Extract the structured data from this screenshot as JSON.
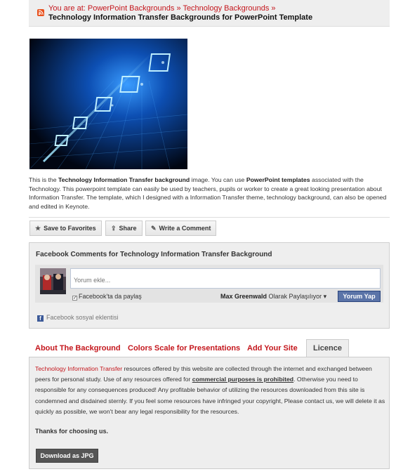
{
  "breadcrumb": {
    "prefix": "You are at:",
    "crumb1": "PowerPoint Backgrounds",
    "sep": "»",
    "crumb2": "Technology Backgrounds",
    "trail_end": "»",
    "title": "Technology Information Transfer Backgrounds for PowerPoint Template"
  },
  "description": {
    "p1": "This is the ",
    "b1": "Technology Information Transfer background",
    "p2": " image. You can use ",
    "b2": "PowerPoint templates",
    "p3": " associated with the Technology. This powerpoint template can easily be used by teachers, pupils or worker to create a great looking presentation about Information Transfer. The template, which I designed with a Information Transfer theme, technology background, can also be opened and edited in Keynote."
  },
  "actions": {
    "save": "Save to Favorites",
    "share": "Share",
    "comment": "Write a Comment"
  },
  "facebook": {
    "title": "Facebook Comments for Technology Information Transfer Background",
    "placeholder": "Yorum ekle...",
    "share_label": "Facebook'ta da paylaş",
    "user": "Max Greenwald",
    "posting_as": "Olarak Paylaşılıyor",
    "post_button": "Yorum Yap",
    "plugin_label": "Facebook sosyal eklentisi"
  },
  "tabs": [
    {
      "label": "About The Background"
    },
    {
      "label": "Colors Scale for Presentations"
    },
    {
      "label": "Add Your Site"
    },
    {
      "label": "Licence"
    }
  ],
  "licence": {
    "link": "Technology Information Transfer",
    "t1": " resources offered by this website are collected through the internet and exchanged between peers for personal study. Use of any resources offered for ",
    "b1": "commercial purposes is prohibited",
    "t2": ". Otherwise you need to responsible for any consequences produced! Any profitable behavior of utilizing the resources downloaded from this site is condemned and disdained sternly. If you feel some resources have infringed your copyright, Please contact us, we will delete it as quickly as possible, we won't bear any legal responsibility for the resources.",
    "thanks": "Thanks for choosing us.",
    "download": "Download as JPG"
  },
  "colors": {
    "accent_red": "#c4161c",
    "facebook_blue": "#5b74a8",
    "panel_gray": "#eeeeee"
  }
}
